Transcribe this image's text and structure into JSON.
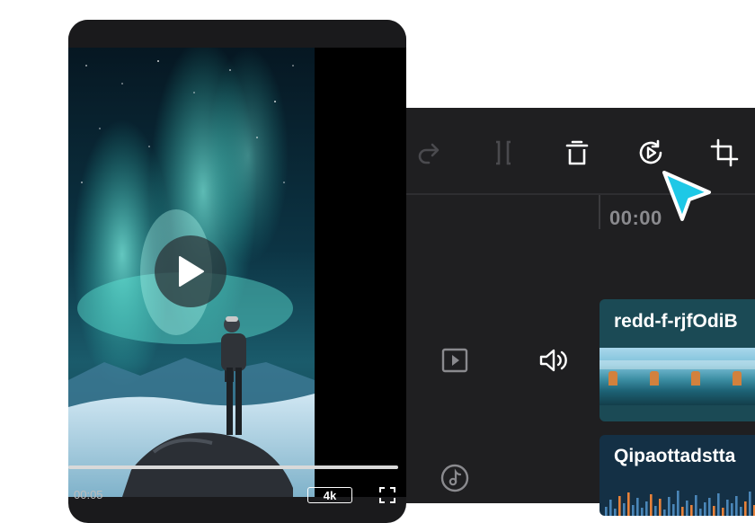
{
  "preview": {
    "time": "00:05",
    "quality": "4k"
  },
  "toolbar": {
    "icons": [
      "redo-icon",
      "split-icon",
      "delete-icon",
      "replay-icon",
      "crop-icon"
    ]
  },
  "timeline": {
    "time": "00:00"
  },
  "tracks": {
    "video_clip_name": "redd-f-rjfOdiB",
    "audio_clip_name": "Qipaottadstta"
  },
  "colors": {
    "accent": "#1ec8e6",
    "editor_bg": "#1f1f21",
    "video_clip": "#1b4a55",
    "audio_clip": "#143045"
  }
}
